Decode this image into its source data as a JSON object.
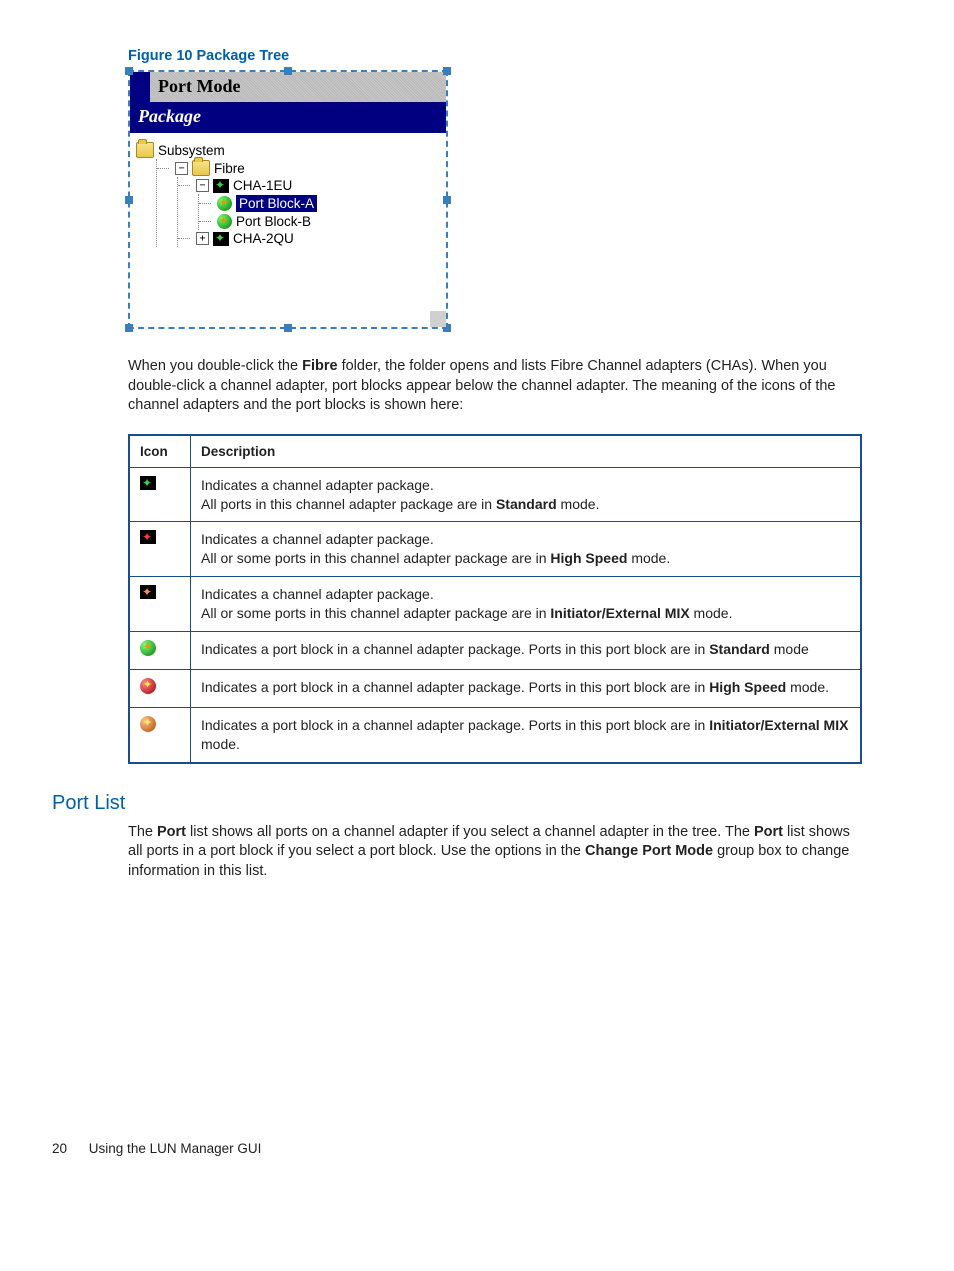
{
  "figure": {
    "caption": "Figure 10 Package Tree",
    "title_bar": "Port Mode",
    "header": "Package",
    "tree": {
      "root": "Subsystem",
      "fibre": "Fibre",
      "cha1": "CHA-1EU",
      "portA": "Port Block-A",
      "portB": "Port Block-B",
      "cha2": "CHA-2QU"
    }
  },
  "para1": {
    "t1": "When you double-click the ",
    "b1": "Fibre",
    "t2": " folder, the folder opens and lists Fibre Channel adapters (CHAs). When you double-click a channel adapter, port blocks appear below the channel adapter. The meaning of the icons of the channel adapters and the port blocks is shown here:"
  },
  "table": {
    "h_icon": "Icon",
    "h_desc": "Description",
    "rows": [
      {
        "icon": "adapter-green",
        "l1": "Indicates a channel adapter package.",
        "l2a": "All ports in this channel adapter package are in ",
        "l2b": "Standard",
        "l2c": " mode."
      },
      {
        "icon": "adapter-red",
        "l1": "Indicates a channel adapter package.",
        "l2a": "All or some ports in this channel adapter package are in ",
        "l2b": "High Speed",
        "l2c": " mode."
      },
      {
        "icon": "adapter-mix",
        "l1": "Indicates a channel adapter package.",
        "l2a": "All or some ports in this channel adapter package are in ",
        "l2b": "Initiator/External MIX",
        "l2c": " mode."
      },
      {
        "icon": "ball-green",
        "l1a": "Indicates a port block in a channel adapter package. Ports in this port block are in ",
        "l1b": "Standard",
        "l1c": " mode"
      },
      {
        "icon": "ball-red",
        "l1a": "Indicates a port block in a channel adapter package. Ports in this port block are in ",
        "l1b": "High Speed",
        "l1c": " mode."
      },
      {
        "icon": "ball-mix",
        "l1a": "Indicates a port block in a channel adapter package. Ports in this port block are in ",
        "l1b": "Initiator/External MIX",
        "l1c": " mode."
      }
    ]
  },
  "portlist": {
    "heading": "Port List",
    "t1": "The ",
    "b1": "Port",
    "t2": " list shows all ports on a channel adapter if you select a channel adapter in the tree. The ",
    "b2": "Port",
    "t3": " list shows all ports in a port block if you select a port block. Use the options in the ",
    "b3": "Change Port Mode",
    "t4": " group box to change information in this list."
  },
  "footer": {
    "page": "20",
    "title": "Using the LUN Manager GUI"
  }
}
